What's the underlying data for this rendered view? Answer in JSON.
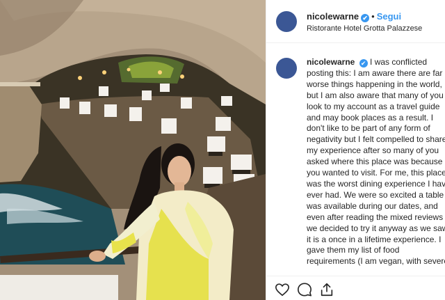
{
  "post": {
    "username": "nicolewarne",
    "verified_mark": "✔",
    "separator": "•",
    "follow_label": "Segui",
    "location": "Ristorante Hotel Grotta Palazzese",
    "photo_description_icon": "photo",
    "caption_lines": [
      "I was conflicted",
      "posting this: I am aware there are far",
      "worse things happening in the world,",
      "but I am also aware that many of you",
      "look to my account as a travel guide",
      "and may book places as a result. I",
      "don't like to be part of any form of",
      "negativity but I felt compelled to share",
      "my experience after so many of you",
      "asked where this place was because",
      "you wanted to visit. For me, this place",
      "was the worst dining experience I have",
      "ever had. We were so excited a table",
      "was available during our dates, and",
      "even after reading the mixed reviews",
      "we decided to try it anyway as we saw",
      "it is a once in a lifetime experience. I",
      "gave them my list of food",
      "requirements (I am vegan, with severe"
    ]
  },
  "actions": {
    "like_icon": "heart-icon",
    "comment_icon": "comment-icon",
    "share_icon": "share-icon"
  },
  "colors": {
    "avatar": "#3b5795",
    "link": "#3897f0",
    "text": "#262626",
    "border": "#efefef"
  }
}
